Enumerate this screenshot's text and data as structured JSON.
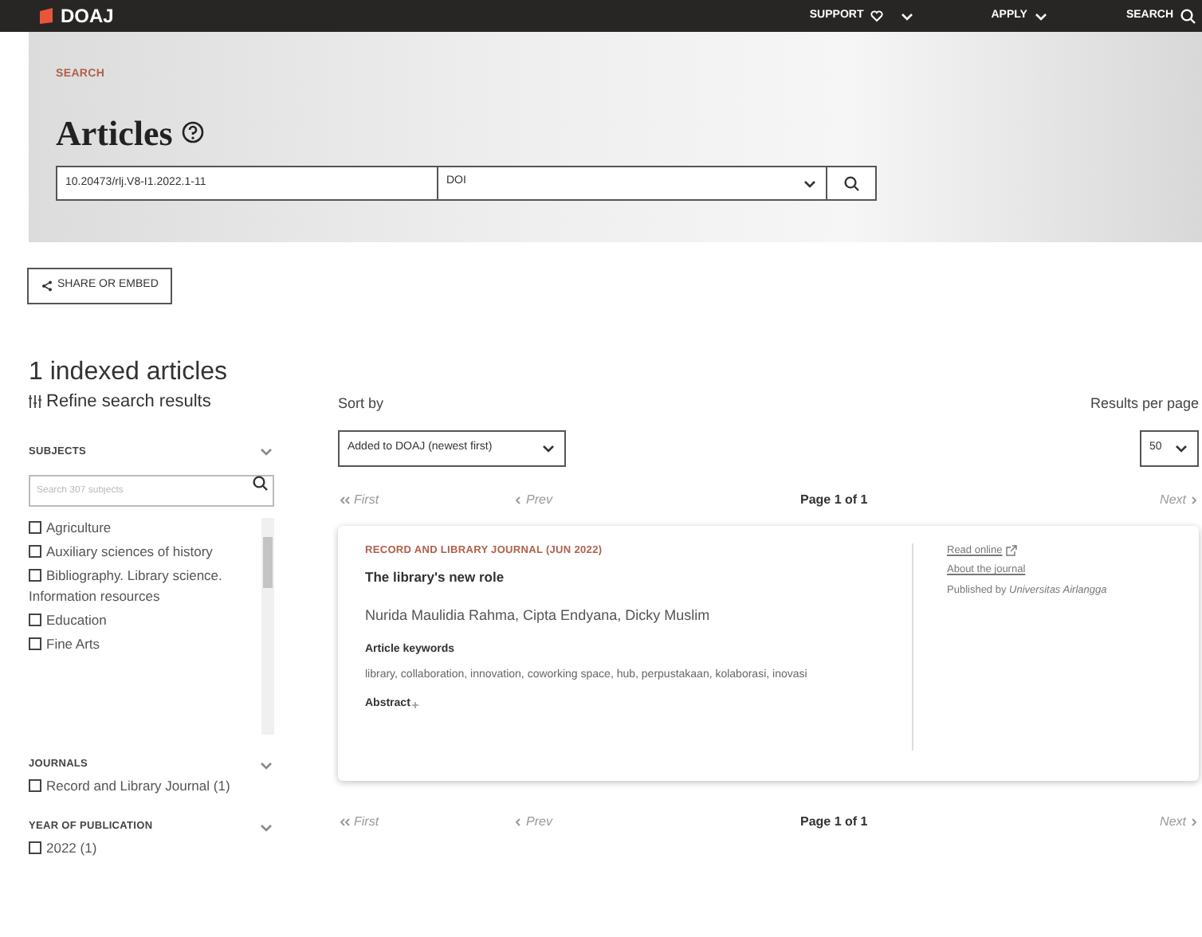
{
  "topbar": {
    "logo": "DOAJ",
    "nav": [
      {
        "label": "SUPPORT",
        "kind": "heart-menu"
      },
      {
        "label": "APPLY",
        "kind": "menu"
      },
      {
        "label": "SEARCH",
        "kind": "search"
      }
    ]
  },
  "hero": {
    "eyebrow": "SEARCH",
    "title": "Articles",
    "query": "10.20473/rlj.V8-I1.2022.1-11",
    "field": "DOI"
  },
  "share_button": "SHARE OR EMBED",
  "result_count": "1 indexed articles",
  "refine_title": "Refine search results",
  "facets": [
    {
      "title": "SUBJECTS",
      "search_placeholder": "Search 307 subjects",
      "scroll": true,
      "items": [
        {
          "label": "Agriculture",
          "checked": false
        },
        {
          "label": "Auxiliary sciences of history",
          "checked": false
        },
        {
          "label": "Bibliography. Library science. Information resources",
          "checked": false
        },
        {
          "label": "Education",
          "checked": false
        },
        {
          "label": "Fine Arts",
          "checked": false
        }
      ]
    },
    {
      "title": "JOURNALS",
      "items": [
        {
          "label": "Record and Library Journal (1)",
          "checked": false
        }
      ]
    },
    {
      "title": "YEAR OF PUBLICATION",
      "items": [
        {
          "label": "2022 (1)",
          "checked": false
        }
      ]
    }
  ],
  "sort": {
    "label": "Sort by",
    "value": "Added to DOAJ (newest first)"
  },
  "per_page": {
    "label": "Results per page",
    "value": "50"
  },
  "pagination": [
    {
      "first": "First",
      "prev": "Prev",
      "page": "Page 1 of 1",
      "next": "Next"
    },
    {
      "first": "First",
      "prev": "Prev",
      "page": "Page 1 of 1",
      "next": "Next"
    }
  ],
  "results": [
    {
      "source": "RECORD AND LIBRARY JOURNAL (JUN 2022)",
      "title": "The library's new role",
      "authors": "Nurida Maulidia Rahma, Cipta Endyana, Dicky Muslim",
      "keywords_label": "Article keywords",
      "keywords": "library, collaboration, innovation, coworking space, hub, perpustakaan, kolaborasi, inovasi",
      "abstract": "Abstract",
      "read_online": "Read online",
      "about": "About the journal",
      "published_by": "Published by",
      "publisher": "Universitas Airlangga"
    }
  ]
}
